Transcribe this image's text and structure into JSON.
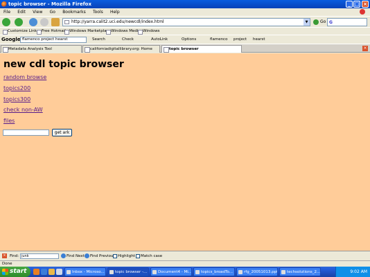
{
  "window": {
    "title": "topic browser - Mozilla Firefox"
  },
  "menu": [
    "File",
    "Edit",
    "View",
    "Go",
    "Bookmarks",
    "Tools",
    "Help"
  ],
  "navigation": {
    "url": "http://yarra.calit2.uci.edu/newcdl/index.html",
    "go_label": "Go"
  },
  "bookmarks": [
    "Customize Links",
    "Free Hotmail",
    "Windows Marketplace",
    "Windows Media",
    "Windows"
  ],
  "google_toolbar": {
    "logo": "Google",
    "search_value": "flamenco project hearst",
    "items": [
      "Search",
      "Check",
      "AutoLink",
      "Options",
      "flamenco",
      "project",
      "hearst"
    ]
  },
  "tabs": [
    {
      "label": "Metadata Analysis Tool",
      "active": false
    },
    {
      "label": "californiadigitallibrary.org: Home",
      "active": false
    },
    {
      "label": "topic browser",
      "active": true
    }
  ],
  "page": {
    "heading": "new cdl topic browser",
    "links": [
      "random browse",
      "topics200",
      "topics300",
      "check non-AW",
      "files"
    ],
    "ark_input_value": "",
    "get_ark_label": "get ark"
  },
  "findbar": {
    "label": "Find:",
    "value": "junk",
    "find_next": "Find Next",
    "find_previous": "Find Previous",
    "highlight": "Highlight",
    "match_case": "Match case"
  },
  "status": "Done",
  "taskbar": {
    "start": "start",
    "tasks": [
      {
        "label": "Inbox - Microso...",
        "active": false
      },
      {
        "label": "topic browser -...",
        "active": true
      },
      {
        "label": "Document4 - Mi...",
        "active": false
      },
      {
        "label": "topics_broadTo...",
        "active": false
      },
      {
        "label": "rfg_20051013.ppt",
        "active": false
      },
      {
        "label": "techsolutions_2...",
        "active": false
      }
    ],
    "clock": "9:02 AM"
  },
  "colors": {
    "page_background": "#ffcc99",
    "link": "#551a8b",
    "titlebar": "#0a5ddf",
    "taskbar": "#245ede",
    "start_button": "#3f9c3a"
  }
}
